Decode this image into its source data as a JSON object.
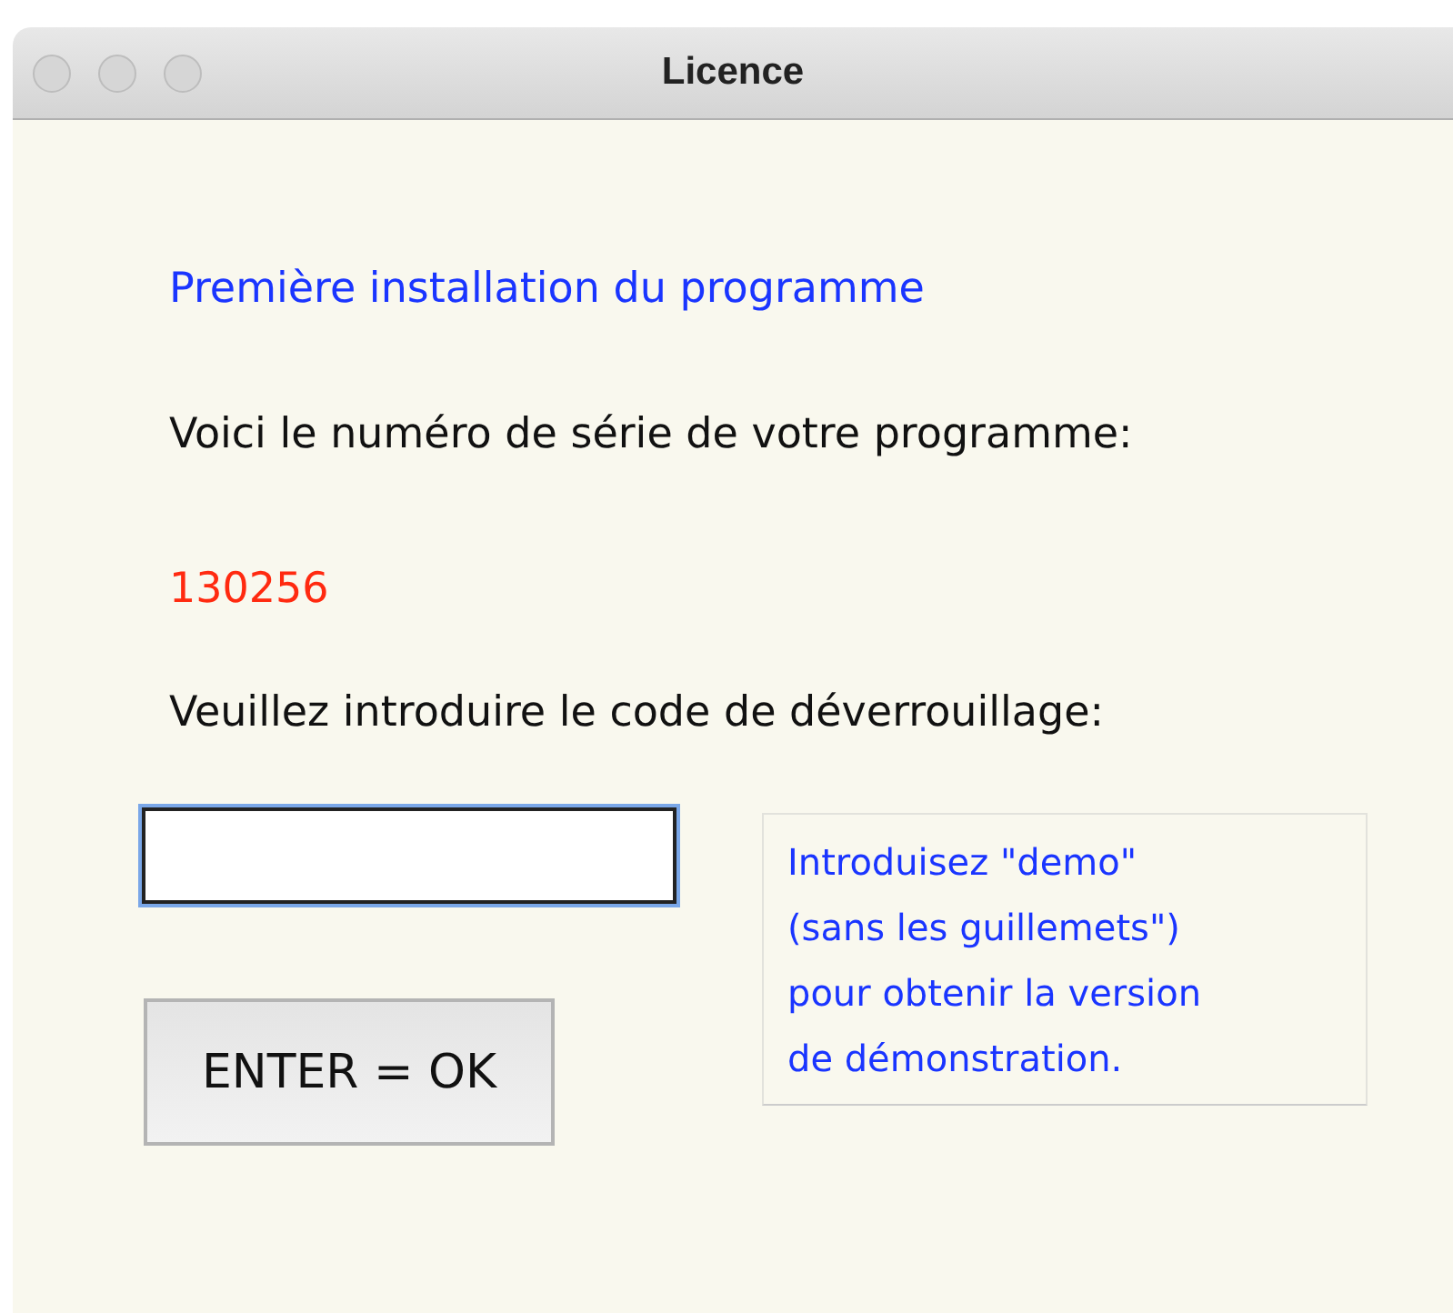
{
  "window": {
    "title": "Licence"
  },
  "heading": "Première installation du programme",
  "serial_label": "Voici le numéro de série de votre programme:",
  "serial_number": "130256",
  "unlock_label": "Veuillez introduire le code de déverrouillage:",
  "code_field": {
    "focused": true
  },
  "ok_button": "ENTER = OK",
  "hint_lines": [
    "Introduisez \"demo\"",
    "(sans les guillemets\")",
    "pour obtenir la version",
    "de démonstration."
  ]
}
